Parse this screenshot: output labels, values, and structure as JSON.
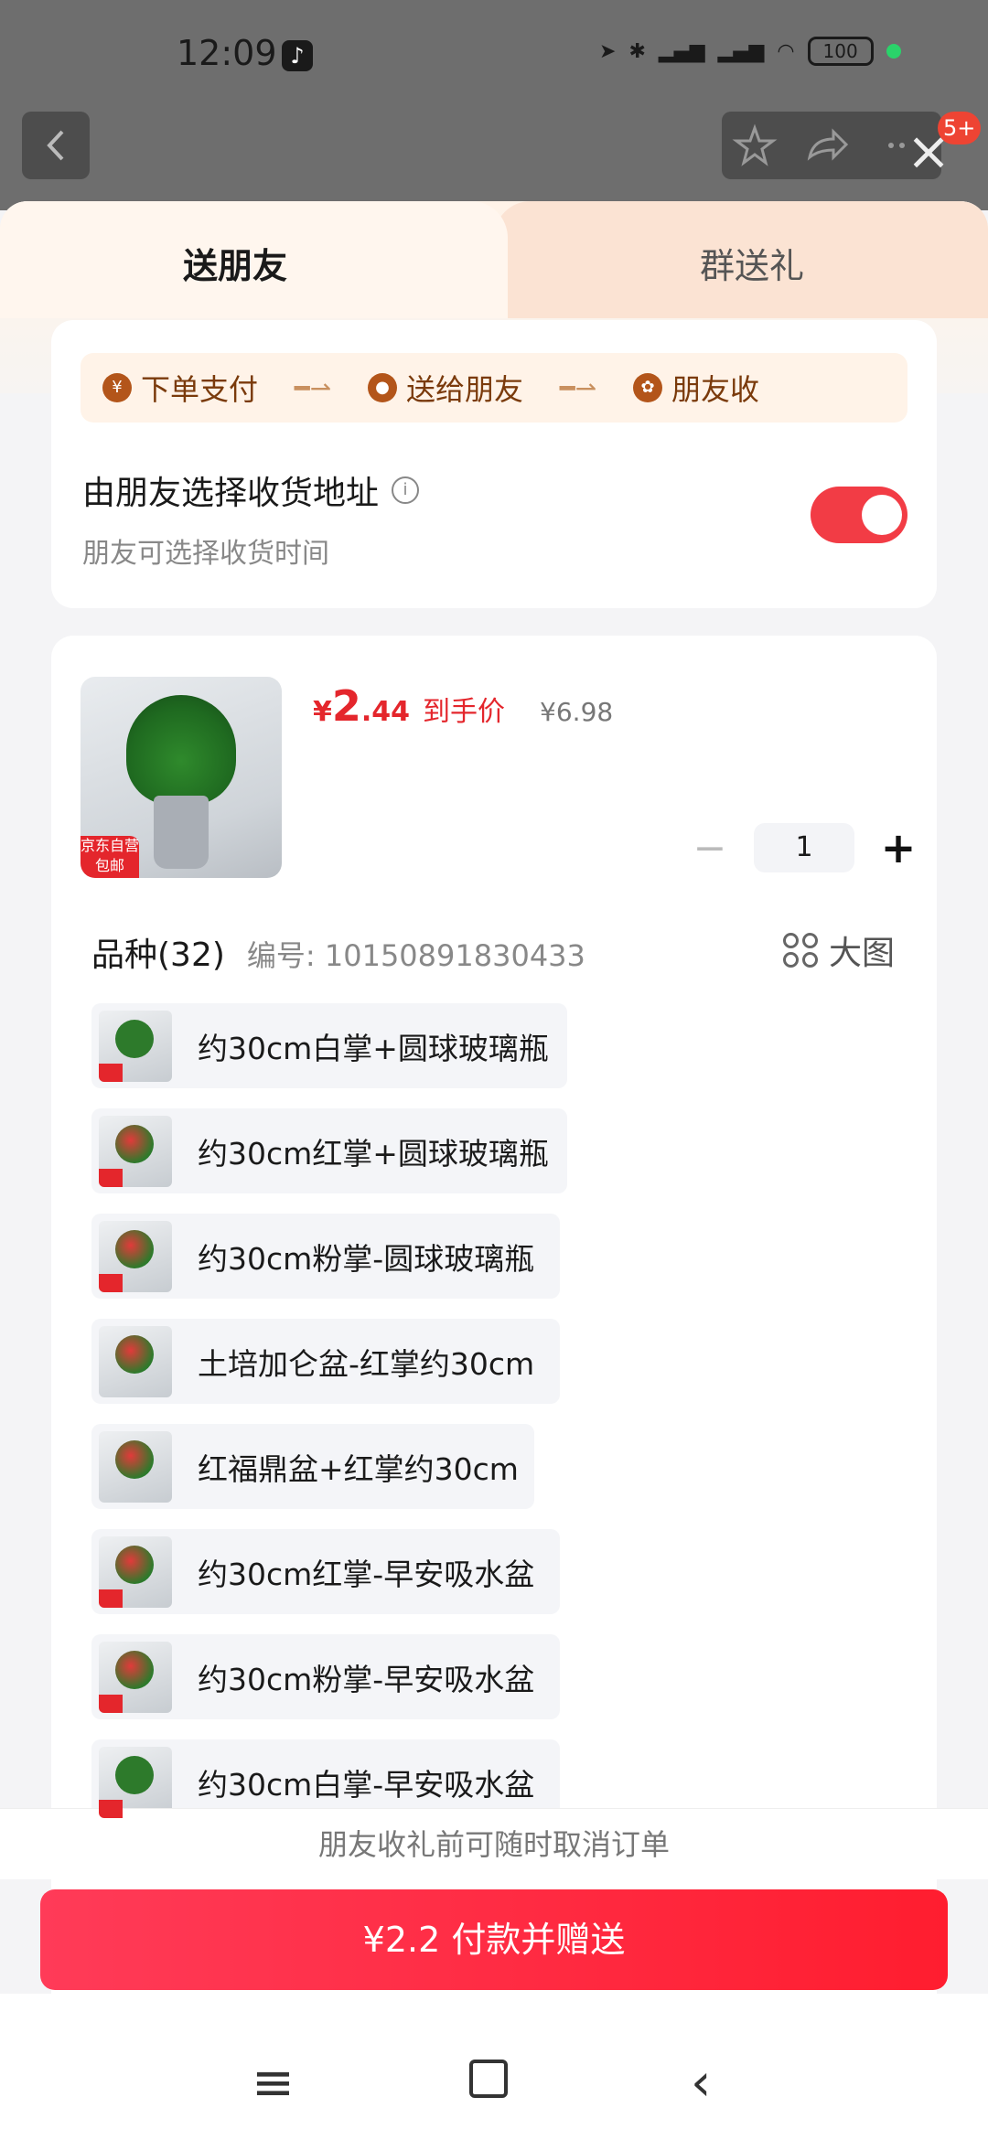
{
  "status": {
    "time": "12:09",
    "battery": "100"
  },
  "topbar": {
    "badge": "5+"
  },
  "tabs": [
    {
      "label": "送朋友"
    },
    {
      "label": "群送礼"
    }
  ],
  "flow": [
    {
      "icon_char": "¥",
      "label": "下单支付"
    },
    {
      "icon_char": "●",
      "label": "送给朋友"
    },
    {
      "icon_char": "✿",
      "label": "朋友收"
    }
  ],
  "address": {
    "title": "由朋友选择收货地址",
    "subtitle": "朋友可选择收货时间",
    "toggle_on": true
  },
  "product": {
    "currency": "¥",
    "price_int": "2",
    "price_dec": ".44",
    "price_label": "到手价",
    "original_price": "¥6.98",
    "jd_tag": "京东自营 包邮",
    "quantity": "1"
  },
  "variants": {
    "title": "品种(32)",
    "code": "编号: 10150891830433",
    "big_image_label": "大图",
    "items": [
      {
        "label": "约30cm白掌+圆球玻璃瓶",
        "thumb": "green"
      },
      {
        "label": "约30cm红掌+圆球玻璃瓶",
        "thumb": "red"
      },
      {
        "label": "约30cm粉掌-圆球玻璃瓶",
        "thumb": "red"
      },
      {
        "label": "土培加仑盆-红掌约30cm",
        "thumb": "red"
      },
      {
        "label": "红福鼎盆+红掌约30cm",
        "thumb": "red"
      },
      {
        "label": "约30cm红掌-早安吸水盆",
        "thumb": "red"
      },
      {
        "label": "约30cm粉掌-早安吸水盆",
        "thumb": "red"
      },
      {
        "label": "约30cm白掌-早安吸水盆",
        "thumb": "green"
      }
    ]
  },
  "footer": {
    "notice": "朋友收礼前可随时取消订单",
    "pay_button": "¥2.2 付款并赠送"
  },
  "colors": {
    "accent": "#e4262c",
    "button": "#ff2a40",
    "toggle": "#f23c45"
  }
}
